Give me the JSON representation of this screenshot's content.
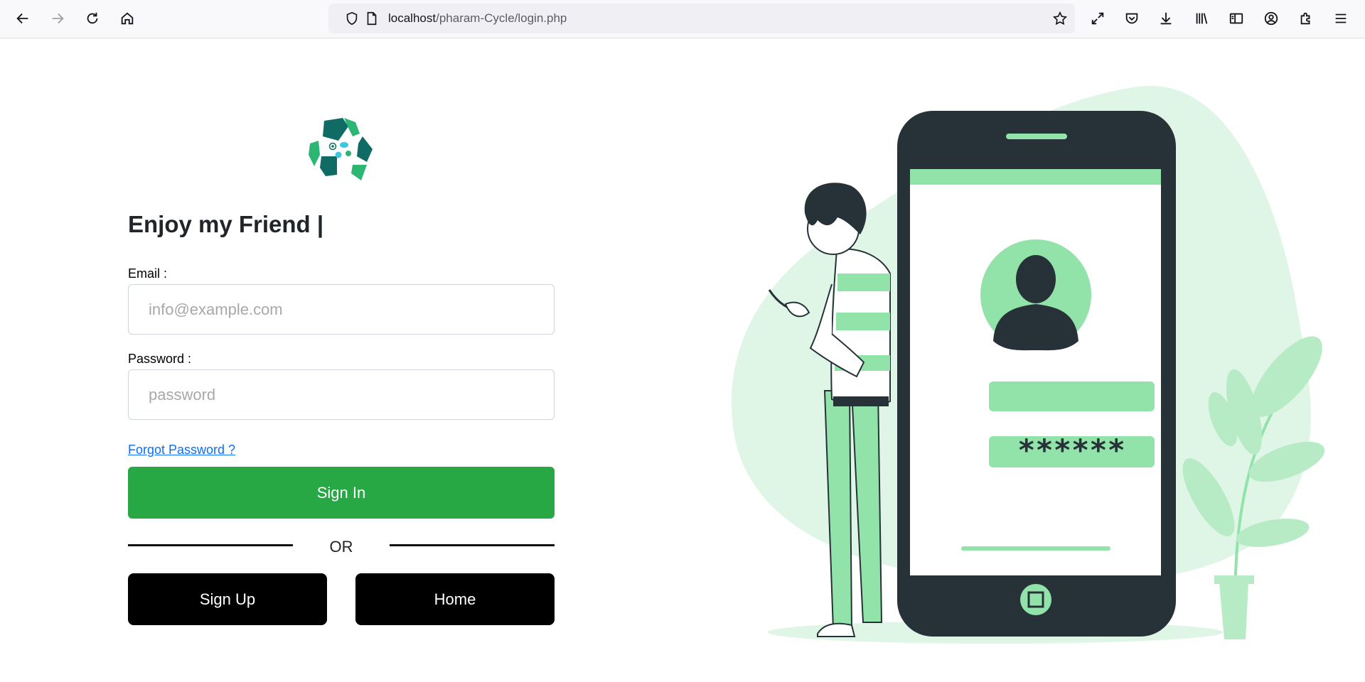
{
  "browser": {
    "url_host": "localhost",
    "url_path": "/pharam-Cycle/login.php",
    "icons": [
      "back-icon",
      "forward-icon",
      "reload-icon",
      "home-icon",
      "shield-icon",
      "page-icon",
      "bookmark-star-icon",
      "fullscreen-icon",
      "pocket-icon",
      "downloads-icon",
      "library-icon",
      "sidebar-icon",
      "account-icon",
      "extensions-icon",
      "menu-icon"
    ]
  },
  "login": {
    "heading": "Enjoy my Friend |",
    "email_label": "Email :",
    "email_placeholder": "info@example.com",
    "email_value": "",
    "password_label": "Password :",
    "password_placeholder": "password",
    "password_value": "",
    "forgot_link": "Forgot Password ?",
    "signin_button": "Sign In",
    "or_text": "OR",
    "signup_button": "Sign Up",
    "home_button": "Home"
  },
  "illustration": {
    "password_mask": "******"
  },
  "colors": {
    "accent_green": "#28a745",
    "illustration_green": "#92e3a9",
    "illustration_light": "#dff5e6",
    "phone_dark": "#263238",
    "link_blue": "#0d6efd"
  }
}
